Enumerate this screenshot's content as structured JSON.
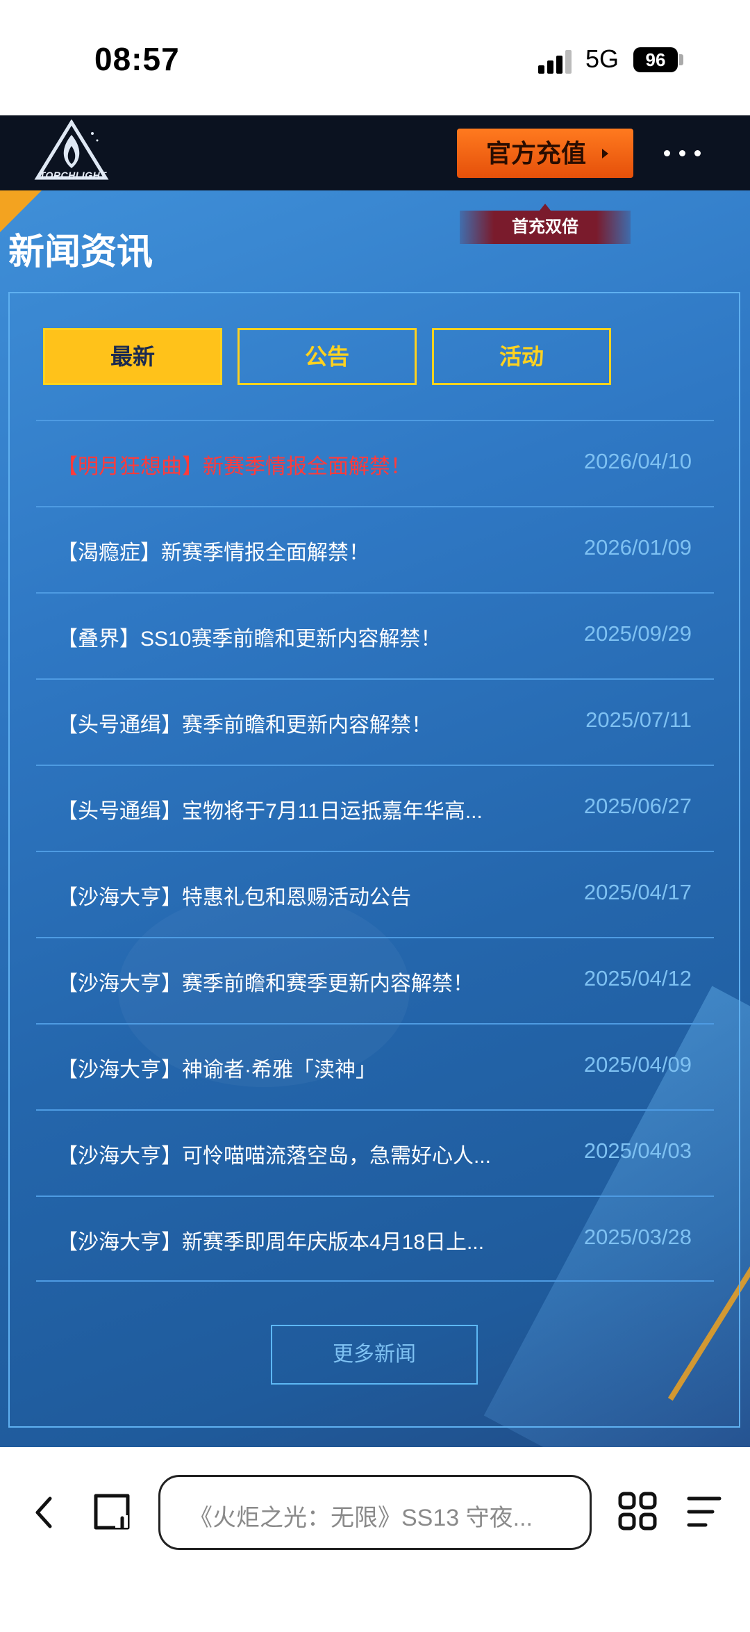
{
  "status_bar": {
    "time": "08:57",
    "network": "5G",
    "battery": "96"
  },
  "header": {
    "logo_text": "TORCHLIGHT",
    "recharge_label": "官方充值",
    "bonus_tag": "首充双倍",
    "more_menu_icon": "more-dots-icon"
  },
  "section": {
    "title": "新闻资讯"
  },
  "tabs": [
    {
      "label": "最新",
      "active": true
    },
    {
      "label": "公告",
      "active": false
    },
    {
      "label": "活动",
      "active": false
    }
  ],
  "news": [
    {
      "title": "【明月狂想曲】新赛季情报全面解禁！",
      "date": "2026/04/10",
      "highlight": true
    },
    {
      "title": "【渴瘾症】新赛季情报全面解禁！",
      "date": "2026/01/09"
    },
    {
      "title": "【叠界】SS10赛季前瞻和更新内容解禁！",
      "date": "2025/09/29"
    },
    {
      "title": "【头号通缉】赛季前瞻和更新内容解禁！",
      "date": "2025/07/11"
    },
    {
      "title": "【头号通缉】宝物将于7月11日运抵嘉年华高...",
      "date": "2025/06/27"
    },
    {
      "title": "【沙海大亨】特惠礼包和恩赐活动公告",
      "date": "2025/04/17"
    },
    {
      "title": "【沙海大亨】赛季前瞻和赛季更新内容解禁！",
      "date": "2025/04/12"
    },
    {
      "title": "【沙海大亨】神谕者·希雅「渎神」",
      "date": "2025/04/09"
    },
    {
      "title": "【沙海大亨】可怜喵喵流落空岛，急需好心人...",
      "date": "2025/04/03"
    },
    {
      "title": "【沙海大亨】新赛季即周年庆版本4月18日上...",
      "date": "2025/03/28"
    }
  ],
  "more_news_label": "更多新闻",
  "browser": {
    "url_title": "《火炬之光：无限》SS13 守夜...",
    "icons": [
      "back-icon",
      "tabs-icon",
      "grid-icon",
      "menu-icon"
    ]
  },
  "colors": {
    "accent_yellow": "#ffc21a",
    "recharge_orange": "#ff7a1f",
    "hot_red": "#ff3b3b",
    "date_blue": "#7ec1f2"
  }
}
